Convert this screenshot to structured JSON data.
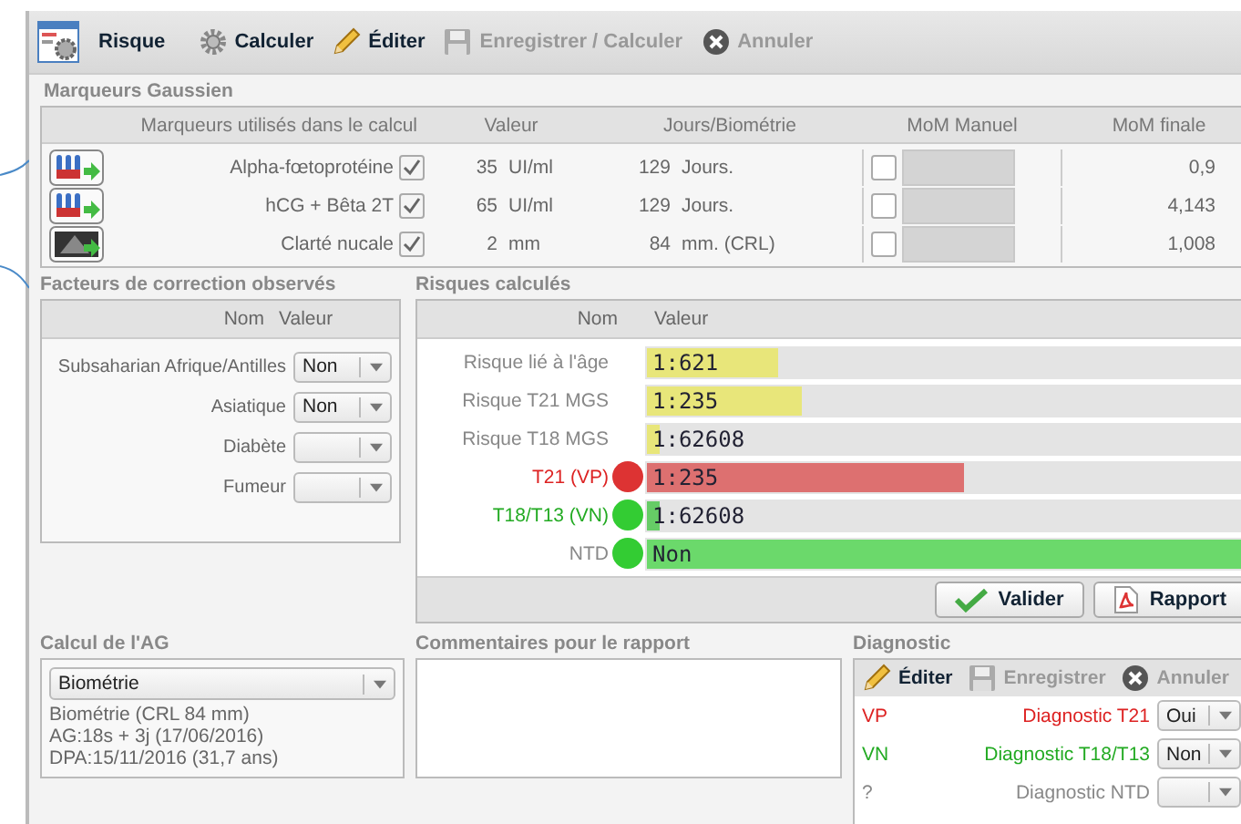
{
  "toolbar": {
    "title": "Risque",
    "items": [
      {
        "kind": "gear",
        "label": "Calculer",
        "disabled": false
      },
      {
        "kind": "pencil",
        "label": "Éditer",
        "disabled": false
      },
      {
        "kind": "floppy",
        "label": "Enregistrer / Calculer",
        "disabled": true
      },
      {
        "kind": "cancel",
        "label": "Annuler",
        "disabled": true
      }
    ]
  },
  "markers": {
    "title": "Marqueurs Gaussien",
    "columns": [
      "Marqueurs utilisés dans le calcul",
      "Valeur",
      "Jours/Biométrie",
      "MoM Manuel",
      "MoM finale"
    ],
    "rows": [
      {
        "kind": "tubes",
        "name": "Alpha-fœtoprotéine",
        "checked": true,
        "value": "35",
        "unit": "UI/ml",
        "days": "129",
        "days_unit": "Jours.",
        "mom_manual": false,
        "mom_final": "0,9"
      },
      {
        "kind": "tubes",
        "name": "hCG + Bêta 2T",
        "checked": true,
        "value": "65",
        "unit": "UI/ml",
        "days": "129",
        "days_unit": "Jours.",
        "mom_manual": false,
        "mom_final": "4,143"
      },
      {
        "kind": "ultrasound",
        "name": "Clarté nucale",
        "checked": true,
        "value": "2",
        "unit": "mm",
        "days": "84",
        "days_unit": "mm. (CRL)",
        "mom_manual": false,
        "mom_final": "1,008"
      }
    ]
  },
  "factors": {
    "title": "Facteurs de correction observés",
    "columns": [
      "Nom",
      "Valeur"
    ],
    "rows": [
      {
        "name": "Subsaharian Afrique/Antilles",
        "value": "Non"
      },
      {
        "name": "Asiatique",
        "value": "Non"
      },
      {
        "name": "Diabète"
      },
      {
        "name": "Fumeur"
      }
    ]
  },
  "risks": {
    "title": "Risques calculés",
    "columns": [
      "Nom",
      "Valeur"
    ],
    "rows": [
      {
        "kind": "mgs",
        "name": "Risque lié à l'âge",
        "value": "1:621",
        "level": 0.22
      },
      {
        "kind": "mgs",
        "name": "Risque T21 MGS",
        "value": "1:235",
        "level": 0.26
      },
      {
        "kind": "mgs",
        "name": "Risque T18 MGS",
        "value": "1:62608",
        "level": 0.02
      },
      {
        "kind": "positive",
        "name": "T21 (VP)",
        "value": "1:235",
        "level": 0.53
      },
      {
        "kind": "negative",
        "name": "T18/T13 (VN)",
        "value": "1:62608",
        "level": 0.02
      },
      {
        "kind": "ntd",
        "name": "NTD",
        "value": "Non",
        "level": 1.0
      }
    ],
    "buttons": [
      {
        "kind": "check",
        "label": "Valider"
      },
      {
        "kind": "pdf",
        "label": "Rapport"
      }
    ]
  },
  "ag": {
    "title": "Calcul de l'AG",
    "method": "Biométrie",
    "lines": [
      "Biométrie  (CRL 84 mm)",
      "AG:18s + 3j (17/06/2016)",
      "DPA:15/11/2016  (31,7 ans)"
    ]
  },
  "comments": {
    "title": "Commentaires pour le rapport"
  },
  "diagnostic": {
    "title": "Diagnostic",
    "toolbar": [
      {
        "kind": "pencil",
        "label": "Éditer",
        "disabled": false
      },
      {
        "kind": "floppy",
        "label": "Enregistrer",
        "disabled": true
      },
      {
        "kind": "cancel",
        "label": "Annuler",
        "disabled": true
      }
    ],
    "rows": [
      {
        "kind": "vp",
        "flag": "VP",
        "label": "Diagnostic T21",
        "value": "Oui"
      },
      {
        "kind": "vn",
        "flag": "VN",
        "label": "Diagnostic T18/T13",
        "value": "Non"
      },
      {
        "kind": "unknown",
        "flag": "?",
        "label": "Diagnostic NTD"
      }
    ]
  }
}
